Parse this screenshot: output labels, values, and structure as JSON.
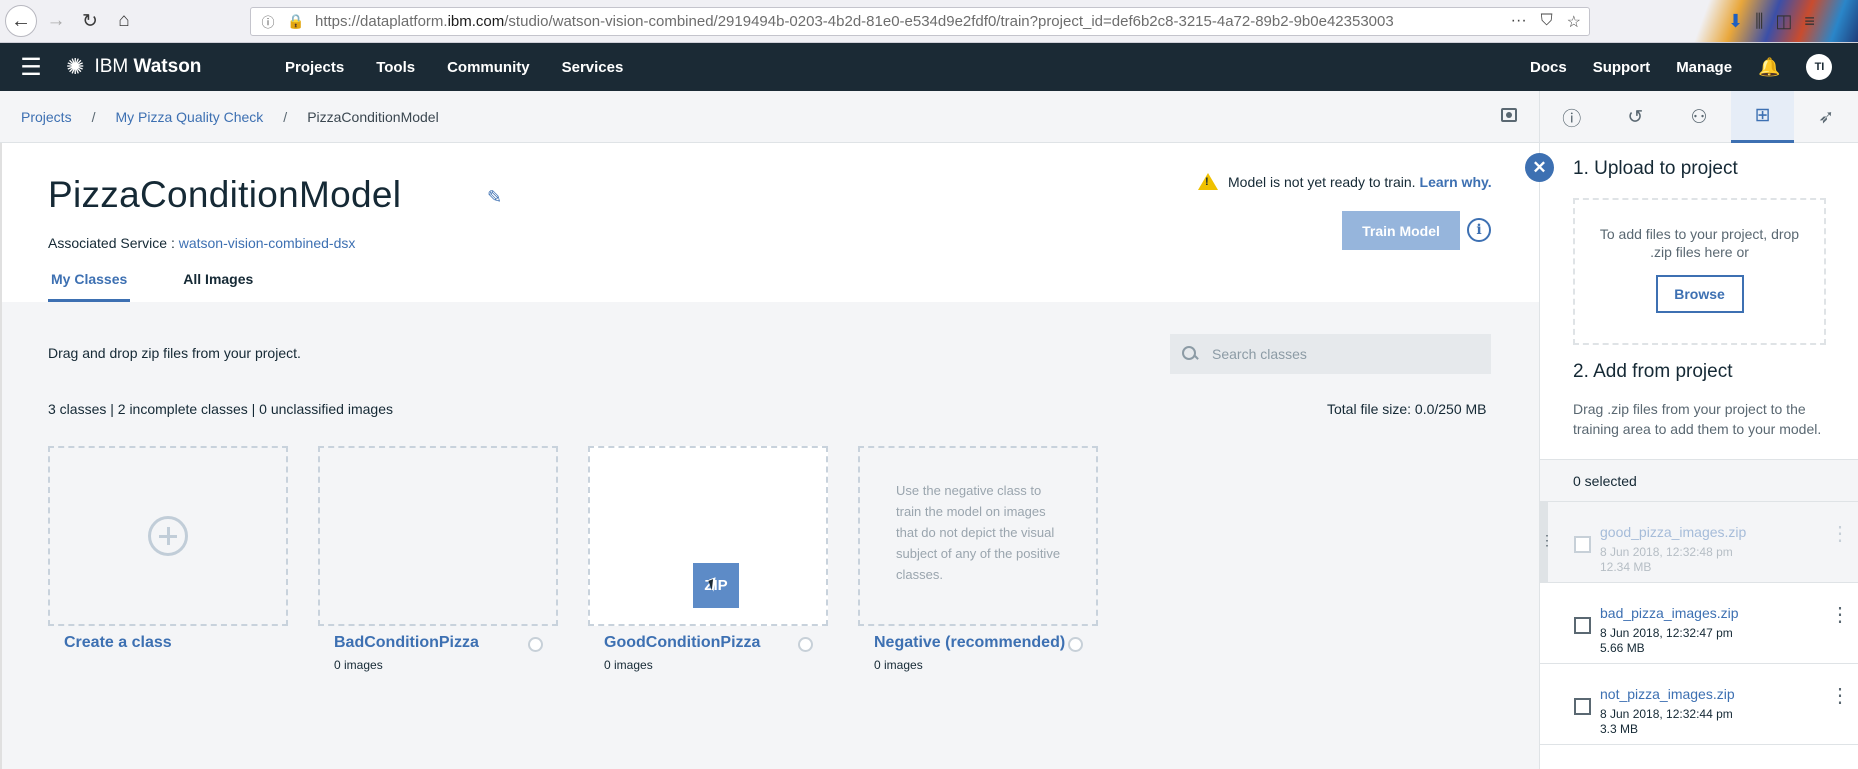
{
  "browser": {
    "url_prefix": "https://dataplatform.",
    "url_domain": "ibm.com",
    "url_suffix": "/studio/watson-vision-combined/2919494b-0203-4b2d-81e0-e534d9e2fdf0/train?project_id=def6b2c8-3215-4a72-89b2-9b0e42353003"
  },
  "header": {
    "brand_light": "IBM ",
    "brand_bold": "Watson",
    "nav": [
      "Projects",
      "Tools",
      "Community",
      "Services"
    ],
    "right": [
      "Docs",
      "Support",
      "Manage"
    ],
    "avatar": "TI"
  },
  "breadcrumb": {
    "items": [
      "Projects",
      "My Pizza Quality Check"
    ],
    "current": "PizzaConditionModel",
    "separator": "/"
  },
  "model": {
    "title": "PizzaConditionModel",
    "assoc_label": "Associated Service : ",
    "assoc_value": "watson-vision-combined-dsx",
    "warning": "Model is not yet ready to train.",
    "warning_link": "Learn why.",
    "train_button": "Train Model",
    "info": "i"
  },
  "tabs": [
    "My Classes",
    "All Images"
  ],
  "content": {
    "drag_tip": "Drag and drop zip files from your project.",
    "search_placeholder": "Search classes",
    "stats": "3 classes | 2 incomplete classes | 0 unclassified images",
    "file_size": "Total file size: 0.0/250 MB"
  },
  "cards": [
    {
      "name": "Create a class",
      "count": ""
    },
    {
      "name": "BadConditionPizza",
      "count": "0 images"
    },
    {
      "name": "GoodConditionPizza",
      "count": "0 images",
      "zip_label": "ZIP"
    },
    {
      "name": "Negative (recommended)",
      "count": "0 images",
      "hint": "Use the negative class to train the model on images that do not depict the visual subject of any of the positive classes."
    }
  ],
  "panel": {
    "upload_title": "1. Upload to project",
    "drop_text": "To add files to your project, drop .zip files here or",
    "browse": "Browse",
    "add_title": "2. Add from project",
    "add_desc": "Drag .zip files from your project to the training area to add them to your model.",
    "selected": "0 selected",
    "files": [
      {
        "name": "good_pizza_images.zip",
        "date": "8 Jun 2018, 12:32:48 pm",
        "size": "12.34 MB"
      },
      {
        "name": "bad_pizza_images.zip",
        "date": "8 Jun 2018, 12:32:47 pm",
        "size": "5.66 MB"
      },
      {
        "name": "not_pizza_images.zip",
        "date": "8 Jun 2018, 12:32:44 pm",
        "size": "3.3 MB"
      }
    ]
  },
  "colors": {
    "accent": "#3d70b2",
    "header_bg": "#1b2a35",
    "warning": "#efc100"
  }
}
